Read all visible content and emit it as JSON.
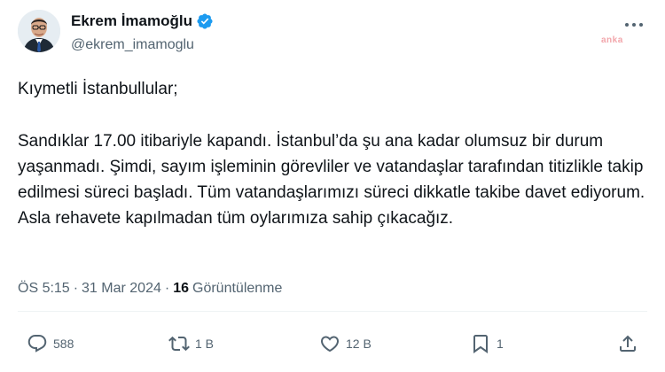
{
  "author": {
    "display_name": "Ekrem İmamoğlu",
    "handle": "@ekrem_imamoglu",
    "verified": true,
    "verified_color": "#1d9bf0"
  },
  "watermark": "anka",
  "tweet": {
    "paragraphs": [
      "Kıymetli İstanbullular;",
      "Sandıklar 17.00 itibariyle kapandı. İstanbul’da şu ana kadar olumsuz bir durum yaşanmadı. Şimdi, sayım işleminin görevliler ve vatandaşlar tarafından titizlikle takip edilmesi süreci başladı. Tüm vatandaşlarımızı süreci dikkatle takibe davet ediyorum. Asla rehavete kapılmadan tüm oylarımıza sahip çıkacağız."
    ]
  },
  "meta": {
    "time": "ÖS 5:15",
    "separator": "·",
    "date": "31 Mar 2024",
    "views_count": "16",
    "views_label": "Görüntülenme"
  },
  "actions": {
    "replies": "588",
    "retweets": "1 B",
    "likes": "12 B",
    "bookmarks": "1"
  },
  "icons": {
    "more": "more-horizontal-icon",
    "reply": "reply-icon",
    "retweet": "retweet-icon",
    "like": "heart-icon",
    "bookmark": "bookmark-icon",
    "share": "share-icon"
  }
}
